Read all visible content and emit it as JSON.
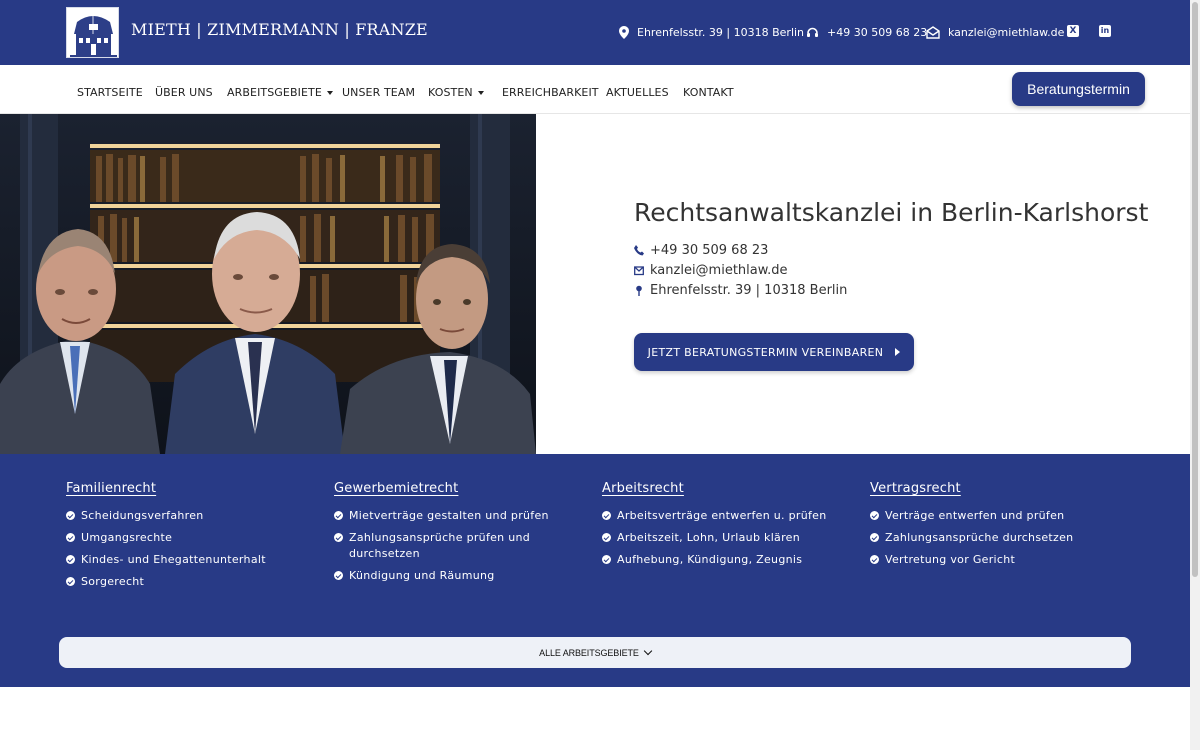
{
  "topbar": {
    "brand": "MIETH | ZIMMERMANN | FRANZE",
    "address": "Ehrenfelsstr. 39 | 10318 Berlin",
    "phone": "+49 30 509 68 23",
    "email": "kanzlei@miethlaw.de",
    "social": [
      {
        "icon": "xing-icon",
        "glyph": "X"
      },
      {
        "icon": "linkedin-icon",
        "glyph": "in"
      }
    ]
  },
  "nav": {
    "items": [
      {
        "label": "STARTSEITE"
      },
      {
        "label": "ÜBER UNS"
      },
      {
        "label": "ARBEITSGEBIETE"
      },
      {
        "label": "UNSER TEAM"
      },
      {
        "label": "KOSTEN"
      },
      {
        "label": "ERREICHBARKEIT"
      },
      {
        "label": "AKTUELLES"
      },
      {
        "label": "KONTAKT"
      }
    ],
    "cta": "Beratungstermin"
  },
  "hero": {
    "title": "Rechtsanwaltskanzlei in Berlin-Karlshorst",
    "phone": "+49 30 509 68 23",
    "email": "kanzlei@miethlaw.de",
    "address": "Ehrenfelsstr. 39 | 10318 Berlin",
    "button": "JETZT BERATUNGSTERMIN VEREINBAREN"
  },
  "areas": [
    {
      "title": "Familienrecht",
      "items": [
        "Scheidungsverfahren",
        "Umgangsrechte",
        "Kindes- und Ehegattenunterhalt",
        "Sorgerecht"
      ]
    },
    {
      "title": "Gewerbemietrecht",
      "items": [
        "Mietverträge gestalten und prüfen",
        "Zahlungsansprüche prüfen und durchsetzen",
        "Kündigung und Räumung"
      ]
    },
    {
      "title": "Arbeitsrecht",
      "items": [
        "Arbeitsverträge entwerfen u. prüfen",
        "Arbeitszeit, Lohn, Urlaub klären",
        "Aufhebung, Kündigung, Zeugnis"
      ]
    },
    {
      "title": "Vertragsrecht",
      "items": [
        "Verträge entwerfen und prüfen",
        "Zahlungsansprüche durchsetzen",
        "Vertretung vor Gericht"
      ]
    }
  ],
  "all_areas_label": "ALLE ARBEITSGEBIETE",
  "colors": {
    "brand": "#283a86",
    "light_band": "#eef1f7"
  }
}
